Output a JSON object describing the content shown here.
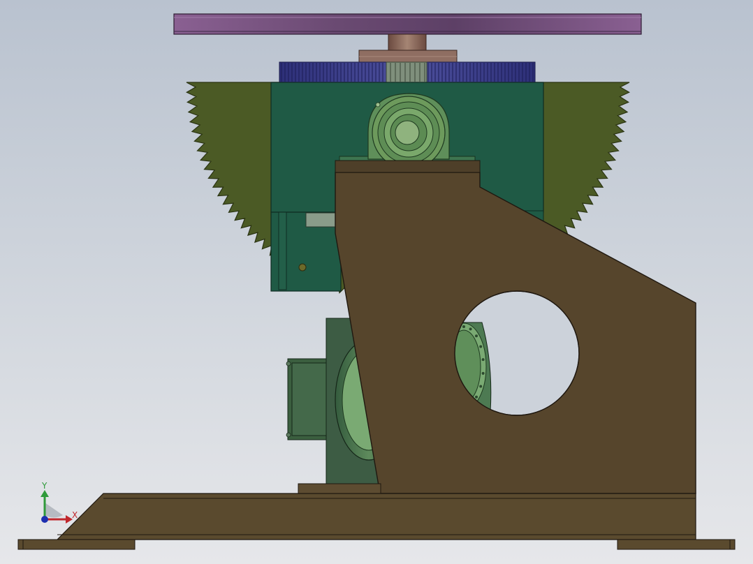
{
  "view": {
    "background_top": "#b9c2cf",
    "background_bottom": "#e6e7ea"
  },
  "model": {
    "parts": [
      {
        "name": "turntable-plate",
        "color": "#7a4f7f"
      },
      {
        "name": "spindle-hub",
        "color": "#8a6a5e"
      },
      {
        "name": "pinion-ring-gear",
        "color": "#3d3f8f"
      },
      {
        "name": "sector-gear",
        "color": "#4b5a25"
      },
      {
        "name": "gearbox-housing",
        "color": "#1f5a45"
      },
      {
        "name": "pillow-block-bearing",
        "color": "#6d9a5c"
      },
      {
        "name": "side-support-frame",
        "color": "#56452c"
      },
      {
        "name": "drive-motor",
        "color": "#3b5f3f"
      },
      {
        "name": "base-frame",
        "color": "#5a4a2e"
      }
    ]
  },
  "triad": {
    "x_label": "X",
    "y_label": "Y",
    "x_color": "#c0282d",
    "y_color": "#2f9a3a",
    "z_color": "#1d2fb0"
  }
}
